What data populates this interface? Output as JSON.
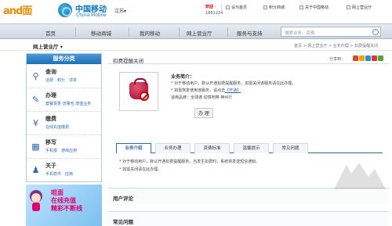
{
  "header": {
    "logo_text": "and面",
    "brand_cn": "中国移动",
    "brand_en": "China Mobile",
    "region": "江苏▾",
    "user_greeting": "欢迎",
    "user_number": "1861224",
    "links": [
      "设为首页",
      "积分商城",
      "关于中国移动",
      "网上营业厅"
    ]
  },
  "nav": {
    "items": [
      "首页",
      "移动商城",
      "我的移动",
      "网上营业厅",
      "服务与支持"
    ],
    "search_placeholder": "搜索业务、资费"
  },
  "subbar": {
    "hall": "网上营业厅 ▾",
    "breadcrumb": "首页 > 网上营业厅 > 业务办理 > 扣费提醒关闭"
  },
  "sidebar": {
    "title": "服务分类",
    "categories": [
      {
        "title": "查询",
        "sub": "话费　积分　详单",
        "icon": "search-icon"
      },
      {
        "title": "办理",
        "sub": "套餐变更 流量包 增值业务",
        "icon": "pen-icon"
      },
      {
        "title": "缴费",
        "sub": "在线充值缴费",
        "icon": "payment-icon"
      },
      {
        "title": "移写",
        "sub": "手机报　游戏应用",
        "icon": "grid-icon"
      },
      {
        "title": "关于",
        "sub": "手机软件　应用",
        "icon": "person-icon"
      }
    ],
    "banner_text": [
      "咀面",
      "在线充值",
      "精彩不断线"
    ]
  },
  "main": {
    "title": "扣费提醒关闭",
    "share_label": "分享到：",
    "product": {
      "name": "业务简介：",
      "line1": "* 对于移动用户，默认开通扣费提醒服务，如需关闭该服务请在此办理。",
      "line2": "* 如需恢复使用该服务，请点击",
      "link": "【开通】",
      "line3": "适用品牌：全球通 动感地带 神州行",
      "button": "办 理"
    },
    "tabs": [
      "业务介绍",
      "业务办理",
      "资费标准",
      "温馨提示",
      "常见问题"
    ],
    "desc": [
      "* 对于移动用户，默认开通扣费提醒服务，当发生扣费时，系统将发送短信通知。",
      "* 如需关闭请在此办理。"
    ],
    "sections": [
      "用户评论",
      "常见问题"
    ]
  }
}
